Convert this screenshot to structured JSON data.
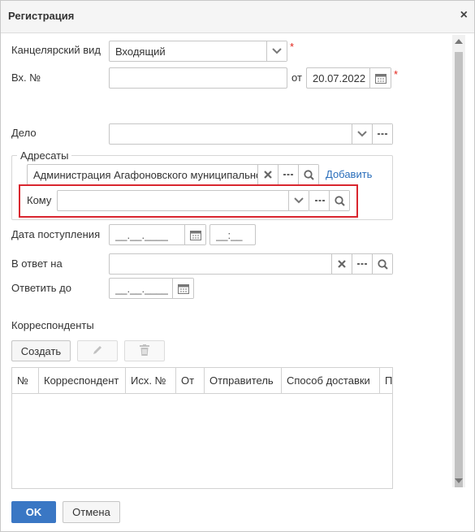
{
  "dialog": {
    "title": "Регистрация",
    "close_glyph": "×"
  },
  "form": {
    "kanc_vid_label": "Канцелярский вид",
    "kanc_vid_value": "Входящий",
    "required_mark": "*",
    "vh_no_label": "Вх. №",
    "vh_no_value": "",
    "ot_label": "от",
    "ot_date": "20.07.2022",
    "delo_label": "Дело",
    "delo_value": "",
    "adresaty_label": "Адресаты",
    "adresat_value": "Администрация Агафоновского муниципальног",
    "add_link": "Добавить",
    "komu_label": "Кому",
    "komu_value": "",
    "data_post_label": "Дата поступления",
    "data_post_date_mask": "__.__.____",
    "data_post_time_mask": "__:__",
    "v_otvet_label": "В ответ на",
    "v_otvet_value": "",
    "otvetit_do_label": "Ответить до",
    "otvetit_do_mask": "__.__.____"
  },
  "correspondents": {
    "section_title": "Корреспонденты",
    "create_label": "Создать",
    "columns": [
      "№",
      "Корреспондент",
      "Исх. №",
      "От",
      "Отправитель",
      "Способ доставки",
      "П"
    ]
  },
  "footer": {
    "ok_label": "OK",
    "cancel_label": "Отмена"
  },
  "icons": [
    "close-icon",
    "chevron-down-icon",
    "calendar-icon",
    "ellipsis-icon",
    "clear-icon",
    "search-icon",
    "pencil-icon",
    "trash-icon"
  ],
  "colors": {
    "accent": "#3a77c4",
    "highlight": "#d9262f",
    "link": "#2a6ebb",
    "required": "#e2231a"
  }
}
